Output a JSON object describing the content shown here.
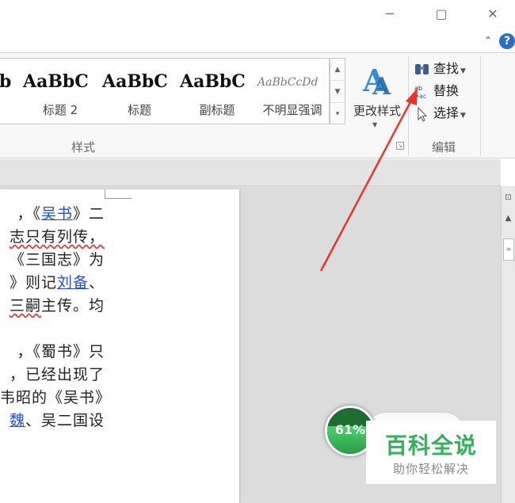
{
  "window": {
    "minimize_glyph": "─",
    "maximize_glyph": "▢",
    "close_glyph": "✕",
    "help_glyph": "?",
    "ribbon_collapse_glyph": "⌃"
  },
  "styles_gallery": {
    "items": [
      {
        "sample": "b",
        "name": ""
      },
      {
        "sample": "AaBbC",
        "name": "标题 2"
      },
      {
        "sample": "AaBbC",
        "name": "标题"
      },
      {
        "sample": "AaBbC",
        "name": "副标题"
      },
      {
        "sample": "AaBbCcDd",
        "name": "不明显强调"
      }
    ],
    "group_label": "样式",
    "change_style_label": "更改样式"
  },
  "editing": {
    "find_label": "查找",
    "replace_label": "替换",
    "select_label": "选择",
    "group_label": "编辑"
  },
  "document": {
    "lines": [
      [
        {
          "t": "，《"
        },
        {
          "t": "吴书",
          "link": true
        },
        {
          "t": "》二"
        }
      ],
      [
        {
          "t": "志只有列传，",
          "wavy": true
        }
      ],
      [
        {
          "t": "《三国志》为"
        }
      ],
      [
        {
          "t": "》则记"
        },
        {
          "t": "刘备",
          "link": true
        },
        {
          "t": "、"
        }
      ],
      [
        {
          "t": "三嗣",
          "wavy": true
        },
        {
          "t": "主传。均"
        }
      ],
      [
        {
          "t": ""
        }
      ],
      [
        {
          "t": "，《蜀书》只"
        }
      ],
      [
        {
          "t": "，已经出现了"
        }
      ],
      [
        {
          "t": "韦昭的《吴书》"
        }
      ],
      [
        {
          "t": "魏",
          "link": true
        },
        {
          "t": "、吴二国设"
        }
      ]
    ]
  },
  "progress": {
    "percent": 61,
    "label": "61%"
  },
  "watermark": {
    "title": "百科全说",
    "subtitle": "助你轻松解决"
  },
  "colors": {
    "accent": "#2b6ec4",
    "link": "#1f4fd6",
    "progress_green": "#2fb25a",
    "annotation_arrow": "#e8342c"
  }
}
